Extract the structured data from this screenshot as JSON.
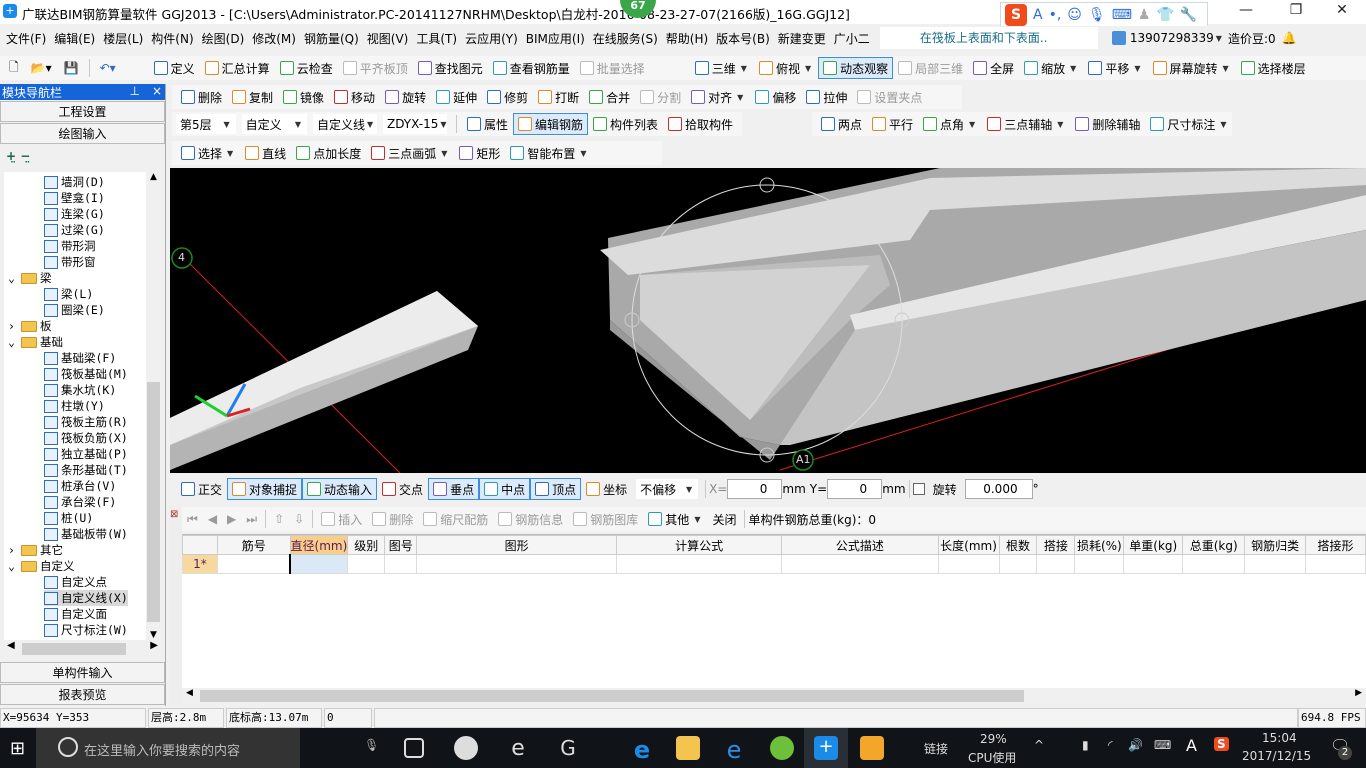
{
  "title": "广联达BIM钢筋算量软件 GGJ2013 - [C:\\Users\\Administrator.PC-20141127NRHM\\Desktop\\白龙村-2016-08-23-27-07(2166版)_16G.GGJ12]",
  "notification_badge": "67",
  "ime_toolbar": {
    "logo": "S",
    "mode": "A"
  },
  "menu": [
    "文件(F)",
    "编辑(E)",
    "楼层(L)",
    "构件(N)",
    "绘图(D)",
    "修改(M)",
    "钢筋量(Q)",
    "视图(V)",
    "工具(T)",
    "云应用(Y)",
    "BIM应用(I)",
    "在线服务(S)",
    "帮助(H)",
    "版本号(B)",
    "新建变更",
    "广小二"
  ],
  "menu_tip": "在筏板上表面和下表面..",
  "user": {
    "phone": "13907298339",
    "beans": "造价豆:0"
  },
  "toolbar1": [
    {
      "label": "定义",
      "icon": "define-icon"
    },
    {
      "label": "汇总计算",
      "icon": "sigma-icon"
    },
    {
      "label": "云检查",
      "icon": "cloud-check-icon"
    },
    {
      "label": "平齐板顶",
      "icon": "align-slab-icon",
      "disabled": true
    },
    {
      "label": "查找图元",
      "icon": "binoculars-icon"
    },
    {
      "label": "查看钢筋量",
      "icon": "view-rebar-icon"
    },
    {
      "label": "批量选择",
      "icon": "batch-select-icon",
      "disabled": true
    }
  ],
  "toolbar1_right": [
    {
      "label": "三维",
      "icon": "cube-3d-icon",
      "dd": true
    },
    {
      "label": "俯视",
      "icon": "top-view-icon",
      "dd": true
    },
    {
      "label": "动态观察",
      "icon": "orbit-icon",
      "active": true
    },
    {
      "label": "局部三维",
      "icon": "local-3d-icon",
      "disabled": true
    },
    {
      "label": "全屏",
      "icon": "fullscreen-icon"
    },
    {
      "label": "缩放",
      "icon": "zoom-icon",
      "dd": true
    },
    {
      "label": "平移",
      "icon": "pan-icon",
      "dd": true
    },
    {
      "label": "屏幕旋转",
      "icon": "rotate-screen-icon",
      "dd": true
    },
    {
      "label": "选择楼层",
      "icon": "select-floor-icon"
    }
  ],
  "toolbar2": [
    {
      "label": "删除",
      "icon": "delete-icon"
    },
    {
      "label": "复制",
      "icon": "copy-icon"
    },
    {
      "label": "镜像",
      "icon": "mirror-icon"
    },
    {
      "label": "移动",
      "icon": "move-icon"
    },
    {
      "label": "旋转",
      "icon": "rotate-icon"
    },
    {
      "label": "延伸",
      "icon": "extend-icon"
    },
    {
      "label": "修剪",
      "icon": "trim-icon"
    },
    {
      "label": "打断",
      "icon": "break-icon"
    },
    {
      "label": "合并",
      "icon": "merge-icon"
    },
    {
      "label": "分割",
      "icon": "split-icon",
      "disabled": true
    },
    {
      "label": "对齐",
      "icon": "align-icon",
      "dd": true
    },
    {
      "label": "偏移",
      "icon": "offset-icon"
    },
    {
      "label": "拉伸",
      "icon": "stretch-icon"
    },
    {
      "label": "设置夹点",
      "icon": "grip-icon",
      "disabled": true
    }
  ],
  "selectors": {
    "floor": "第5层",
    "category": "自定义",
    "type": "自定义线",
    "component": "ZDYX-15"
  },
  "toolbar3": [
    {
      "label": "属性",
      "icon": "properties-icon"
    },
    {
      "label": "编辑钢筋",
      "icon": "edit-rebar-icon",
      "active": true
    },
    {
      "label": "构件列表",
      "icon": "component-list-icon"
    },
    {
      "label": "拾取构件",
      "icon": "pick-icon"
    }
  ],
  "toolbar3_right": [
    {
      "label": "两点",
      "icon": "two-point-axis-icon"
    },
    {
      "label": "平行",
      "icon": "parallel-axis-icon"
    },
    {
      "label": "点角",
      "icon": "point-angle-icon",
      "dd": true
    },
    {
      "label": "三点辅轴",
      "icon": "three-point-axis-icon",
      "dd": true
    },
    {
      "label": "删除辅轴",
      "icon": "delete-axis-icon"
    },
    {
      "label": "尺寸标注",
      "icon": "dimension-icon",
      "dd": true
    }
  ],
  "toolbar4": [
    {
      "label": "选择",
      "icon": "cursor-icon",
      "dd": true
    },
    {
      "label": "直线",
      "icon": "line-icon"
    },
    {
      "label": "点加长度",
      "icon": "point-length-icon"
    },
    {
      "label": "三点画弧",
      "icon": "arc-icon",
      "dd": true
    },
    {
      "label": "矩形",
      "icon": "rectangle-icon"
    },
    {
      "label": "智能布置",
      "icon": "smart-layout-icon",
      "dd": true
    }
  ],
  "nav": {
    "header": "模块导航栏",
    "pin": "ᵖ",
    "close": "×",
    "project_settings": "工程设置",
    "drawing_input": "绘图输入",
    "single_input": "单构件输入",
    "report_preview": "报表预览"
  },
  "tree": [
    {
      "label": "墙洞(D)",
      "level": 2
    },
    {
      "label": "壁龛(I)",
      "level": 2
    },
    {
      "label": "连梁(G)",
      "level": 2
    },
    {
      "label": "过梁(G)",
      "level": 2
    },
    {
      "label": "带形洞",
      "level": 2
    },
    {
      "label": "带形窗",
      "level": 2
    },
    {
      "label": "梁",
      "level": 1,
      "folder": "open"
    },
    {
      "label": "梁(L)",
      "level": 2
    },
    {
      "label": "圈梁(E)",
      "level": 2
    },
    {
      "label": "板",
      "level": 1,
      "folder": "closed"
    },
    {
      "label": "基础",
      "level": 1,
      "folder": "open"
    },
    {
      "label": "基础梁(F)",
      "level": 2
    },
    {
      "label": "筏板基础(M)",
      "level": 2
    },
    {
      "label": "集水坑(K)",
      "level": 2
    },
    {
      "label": "柱墩(Y)",
      "level": 2
    },
    {
      "label": "筏板主筋(R)",
      "level": 2
    },
    {
      "label": "筏板负筋(X)",
      "level": 2
    },
    {
      "label": "独立基础(P)",
      "level": 2
    },
    {
      "label": "条形基础(T)",
      "level": 2
    },
    {
      "label": "桩承台(V)",
      "level": 2
    },
    {
      "label": "承台梁(F)",
      "level": 2
    },
    {
      "label": "桩(U)",
      "level": 2
    },
    {
      "label": "基础板带(W)",
      "level": 2
    },
    {
      "label": "其它",
      "level": 1,
      "folder": "closed"
    },
    {
      "label": "自定义",
      "level": 1,
      "folder": "open"
    },
    {
      "label": "自定义点",
      "level": 2
    },
    {
      "label": "自定义线(X)",
      "level": 2,
      "selected": true
    },
    {
      "label": "自定义面",
      "level": 2
    },
    {
      "label": "尺寸标注(W)",
      "level": 2
    }
  ],
  "viewport": {
    "axis_labels": [
      "4",
      "A1"
    ]
  },
  "snapbar": {
    "items": [
      {
        "label": "正交",
        "icon": "ortho-icon"
      },
      {
        "label": "对象捕捉",
        "icon": "object-snap-icon",
        "active": true
      },
      {
        "label": "动态输入",
        "icon": "dynamic-input-icon",
        "active": true
      },
      {
        "label": "交点",
        "icon": "intersection-icon"
      },
      {
        "label": "垂点",
        "icon": "perpendicular-icon",
        "active": true
      },
      {
        "label": "中点",
        "icon": "midpoint-icon",
        "active": true
      },
      {
        "label": "顶点",
        "icon": "vertex-icon",
        "active": true
      },
      {
        "label": "坐标",
        "icon": "coordinate-icon"
      }
    ],
    "offset_mode": "不偏移",
    "x_label": "X=",
    "x": "0",
    "y_label": "Y=",
    "y": "0",
    "unit": "mm",
    "rotate_label": "旋转",
    "rotate": "0.000",
    "degree": "°"
  },
  "rebarbar": {
    "items": [
      {
        "label": "插入",
        "icon": "insert-icon",
        "disabled": true
      },
      {
        "label": "删除",
        "icon": "delete-row-icon",
        "disabled": true
      },
      {
        "label": "缩尺配筋",
        "icon": "scale-rebar-icon",
        "disabled": true
      },
      {
        "label": "钢筋信息",
        "icon": "rebar-info-icon",
        "disabled": true
      },
      {
        "label": "钢筋图库",
        "icon": "rebar-library-icon",
        "disabled": true
      },
      {
        "label": "其他",
        "icon": "other-icon",
        "dd": true
      },
      {
        "label": "关闭",
        "icon": ""
      }
    ],
    "total": "单构件钢筋总重(kg)：0"
  },
  "grid": {
    "columns": [
      "",
      "筋号",
      "直径(mm)",
      "级别",
      "图号",
      "图形",
      "计算公式",
      "公式描述",
      "长度(mm)",
      "根数",
      "搭接",
      "损耗(%)",
      "单重(kg)",
      "总重(kg)",
      "钢筋归类",
      "搭接形"
    ],
    "rows": [
      [
        "1*",
        "",
        "",
        "",
        "",
        "",
        "",
        "",
        "",
        "",
        "",
        "",
        "",
        "",
        "",
        ""
      ]
    ]
  },
  "status": {
    "coords": "X=95634 Y=353",
    "floor_height": "层高:2.8m",
    "base_elev": "底标高:13.07m",
    "value": "0",
    "fps": "694.8 FPS"
  },
  "taskbar": {
    "search_placeholder": "在这里输入你要搜索的内容",
    "link": "链接",
    "cpu_pct": "29%",
    "cpu_label": "CPU使用",
    "ime": "A",
    "time": "15:04",
    "date": "2017/12/15",
    "notifications": "2"
  }
}
